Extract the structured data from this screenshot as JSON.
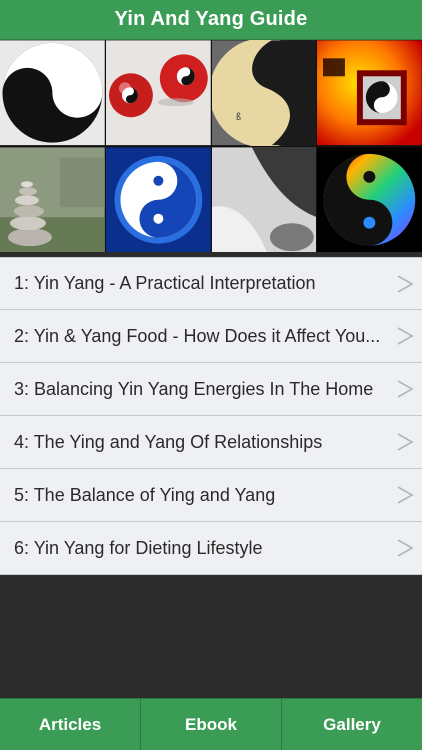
{
  "header": {
    "title": "Yin And Yang Guide"
  },
  "gallery": {
    "tiles": [
      {
        "name": "yin-yang-classic-image"
      },
      {
        "name": "yin-yang-balls-image"
      },
      {
        "name": "yin-yang-rice-image"
      },
      {
        "name": "yin-yang-red-symbol-image"
      },
      {
        "name": "stacked-stones-image"
      },
      {
        "name": "blue-yin-yang-globe-image"
      },
      {
        "name": "rocks-contrast-image"
      },
      {
        "name": "rainbow-yin-yang-image"
      }
    ]
  },
  "articles": [
    {
      "label": "1: Yin Yang - A Practical Interpretation"
    },
    {
      "label": "2: Yin & Yang Food - How Does it Affect You..."
    },
    {
      "label": "3: Balancing Yin Yang Energies In The Home"
    },
    {
      "label": "4: The Ying and Yang Of Relationships"
    },
    {
      "label": "5: The Balance of Ying and Yang"
    },
    {
      "label": "6: Yin Yang for Dieting Lifestyle"
    }
  ],
  "tabs": [
    {
      "label": "Articles"
    },
    {
      "label": "Ebook"
    },
    {
      "label": "Gallery"
    }
  ],
  "colors": {
    "accent": "#3b9c55",
    "list_bg": "#eef0f3",
    "empty_bg": "#2c2c2c"
  }
}
